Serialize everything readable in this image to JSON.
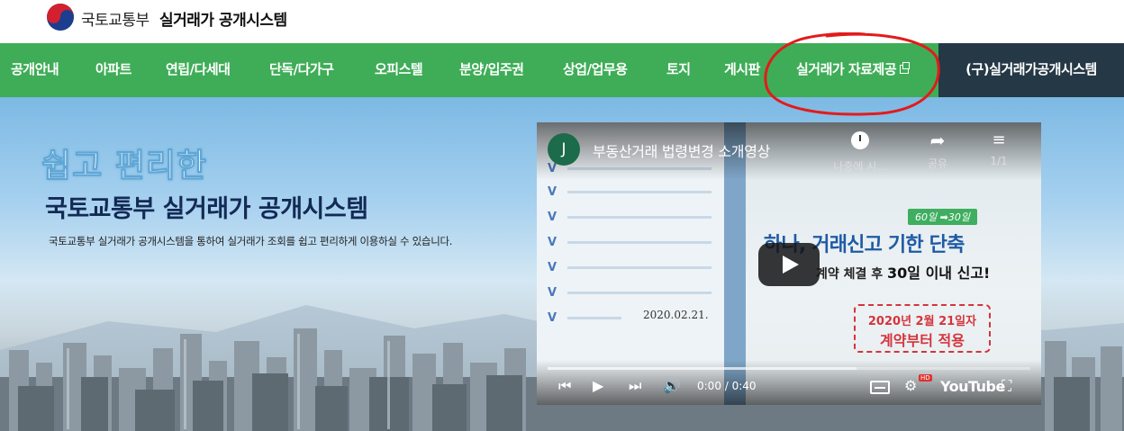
{
  "header": {
    "ministry": "국토교통부",
    "system_title": "실거래가 공개시스템",
    "logo_icon": "taegeuk-logo-icon"
  },
  "nav": {
    "items": [
      {
        "label": "공개안내"
      },
      {
        "label": "아파트"
      },
      {
        "label": "연립/다세대"
      },
      {
        "label": "단독/다가구"
      },
      {
        "label": "오피스텔"
      },
      {
        "label": "분양/입주권"
      },
      {
        "label": "상업/업무용"
      },
      {
        "label": "토지"
      },
      {
        "label": "게시판"
      },
      {
        "label": "실거래가 자료제공",
        "icon": "external-link-icon"
      },
      {
        "label": "(구)실거래가공개시스템"
      }
    ],
    "colors": {
      "bar": "#3fad57",
      "old_system": "#253846"
    }
  },
  "hero": {
    "title1": "쉽고 편리한",
    "title2": "국토교통부 실거래가 공개시스템",
    "description": "국토교통부 실거래가 공개시스템을 통하여 실거래가 조회를 쉽고 편리하게 이용하실 수 있습니다."
  },
  "video": {
    "channel_initial": "J",
    "title": "부동산거래 법령변경 소개영상",
    "actions": [
      {
        "label": "나중에 시...",
        "icon": "clock-icon"
      },
      {
        "label": "공유",
        "icon": "share-icon"
      },
      {
        "label": "1/1",
        "icon": "playlist-icon"
      }
    ],
    "poster": {
      "days_badge": "60일 ➡30일",
      "headline": "하나, 거래신고 기한 단축",
      "sub_prefix": "계약 체결 후",
      "sub_bold": "30일 이내 신고!",
      "stamp_line1": "2020년 2월 21일자",
      "stamp_line2": "계약부터 적용",
      "date": "2020.02.21."
    },
    "time": "0:00 / 0:40",
    "played_fraction": 0.0,
    "buffered_fraction": 0.64,
    "hd_badge": "HD",
    "platform": "YouTube"
  },
  "annotation": {
    "color": "#e21b1b"
  }
}
